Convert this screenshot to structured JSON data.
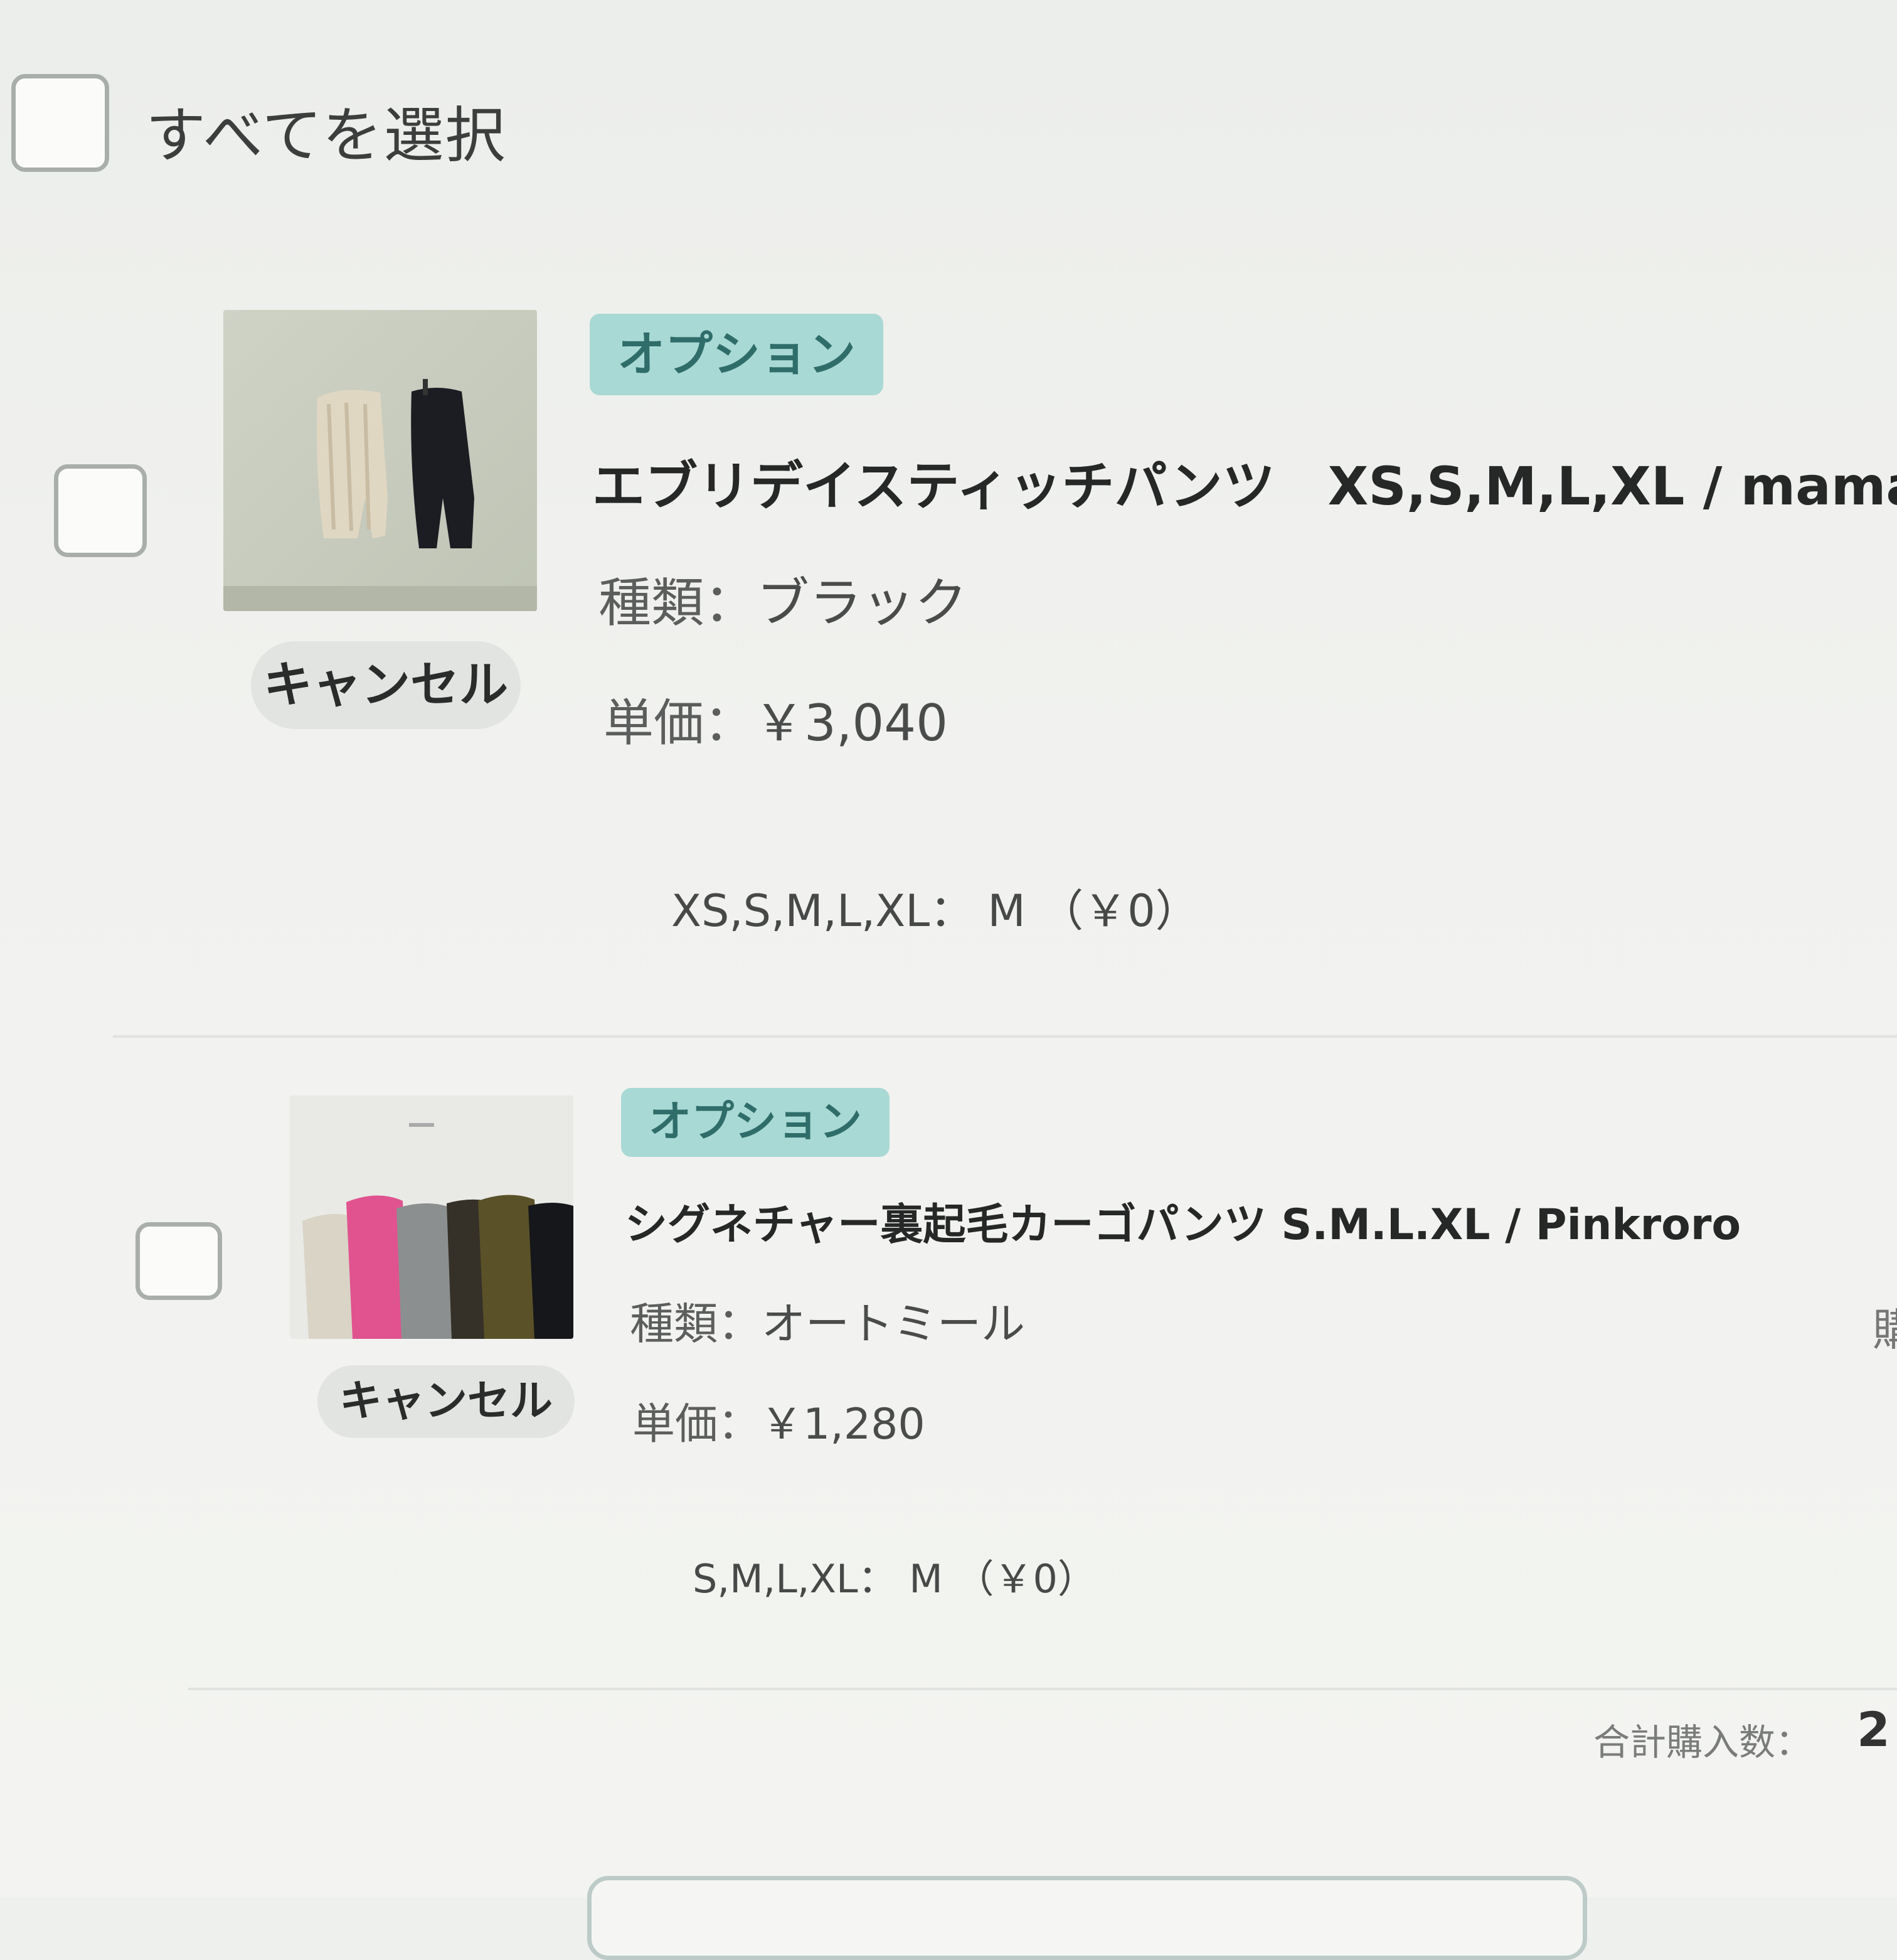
{
  "select_all": {
    "label": "すべてを選択"
  },
  "items": [
    {
      "badge": "オプション",
      "title": "エブリデイスティッチパンツ　XS,S,M,L,XL / mamam",
      "type_key": "種類：",
      "type_value": "ブラック",
      "price_key": "単価：",
      "price_value": "￥3,040",
      "option_line": "XS,S,M,L,XL： M （￥0）",
      "cancel_label": "キャンセル"
    },
    {
      "badge": "オプション",
      "title": "シグネチャー裏起毛カーゴパンツ S.M.L.XL / Pinkroro",
      "type_key": "種類：",
      "type_value": "オートミール",
      "price_key": "単価：",
      "price_value": "￥1,280",
      "option_line": "S,M,L,XL： M （￥0）",
      "cancel_label": "キャンセル"
    }
  ],
  "summary": {
    "total_label": "合計購入数：",
    "total_value": "2",
    "edge_char": "購"
  },
  "colors": {
    "badge_bg": "#a9d9d5",
    "badge_text": "#2f6d6a",
    "cancel_bg": "#e2e4e1"
  }
}
